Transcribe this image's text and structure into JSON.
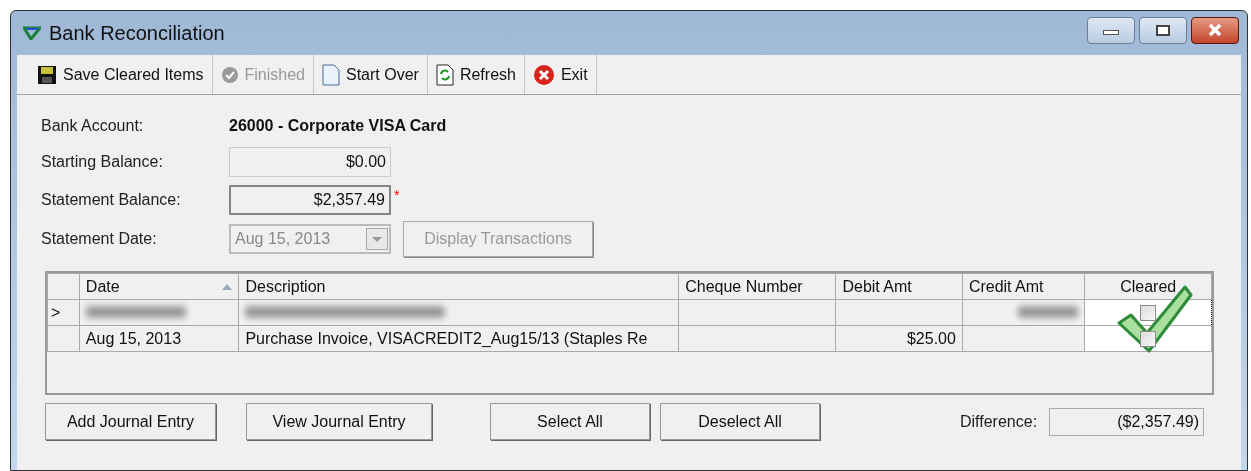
{
  "window": {
    "title": "Bank Reconciliation"
  },
  "toolbar": [
    {
      "label": "Save Cleared Items",
      "kind": "save",
      "disabled": false
    },
    {
      "label": "Finished",
      "kind": "finished",
      "disabled": true
    },
    {
      "label": "Start Over",
      "kind": "page",
      "disabled": false
    },
    {
      "label": "Refresh",
      "kind": "refresh",
      "disabled": false
    },
    {
      "label": "Exit",
      "kind": "exit",
      "disabled": false
    }
  ],
  "form": {
    "bank_account": {
      "label": "Bank Account:",
      "value": "26000 - Corporate VISA Card"
    },
    "starting_balance": {
      "label": "Starting Balance:",
      "value": "$0.00"
    },
    "statement_balance": {
      "label": "Statement Balance:",
      "value": "$2,357.49",
      "required_mark": "*"
    },
    "statement_date": {
      "label": "Statement Date:",
      "value": "Aug 15, 2013",
      "disabled": true
    },
    "display_button": {
      "label": "Display Transactions",
      "disabled": true
    }
  },
  "table": {
    "columns": [
      {
        "label": "Date",
        "sorted": true
      },
      {
        "label": "Description",
        "sorted": false
      },
      {
        "label": "Cheque Number",
        "sorted": false
      },
      {
        "label": "Debit Amt",
        "sorted": false
      },
      {
        "label": "Credit Amt",
        "sorted": false
      },
      {
        "label": "Cleared",
        "sorted": false
      }
    ],
    "rows": [
      {
        "marker": ">",
        "focused": true,
        "cleared": false,
        "cells": [
          {
            "kind": "blurred"
          },
          {
            "kind": "blurred"
          },
          {
            "kind": "empty"
          },
          {
            "kind": "empty"
          },
          {
            "kind": "blurred"
          }
        ]
      },
      {
        "focused": false,
        "cleared": false,
        "cells": [
          {
            "kind": "text",
            "text": "Aug 15, 2013"
          },
          {
            "kind": "text",
            "text": "Purchase Invoice, VISACREDIT2_Aug15/13 (Staples Re"
          },
          {
            "kind": "empty"
          },
          {
            "kind": "text",
            "text": "$25.00"
          },
          {
            "kind": "empty"
          }
        ]
      }
    ]
  },
  "buttons": [
    "Add Journal Entry",
    "View Journal Entry",
    "Select All",
    "Deselect All"
  ],
  "difference": {
    "label": "Difference:",
    "value": "($2,357.49)"
  }
}
